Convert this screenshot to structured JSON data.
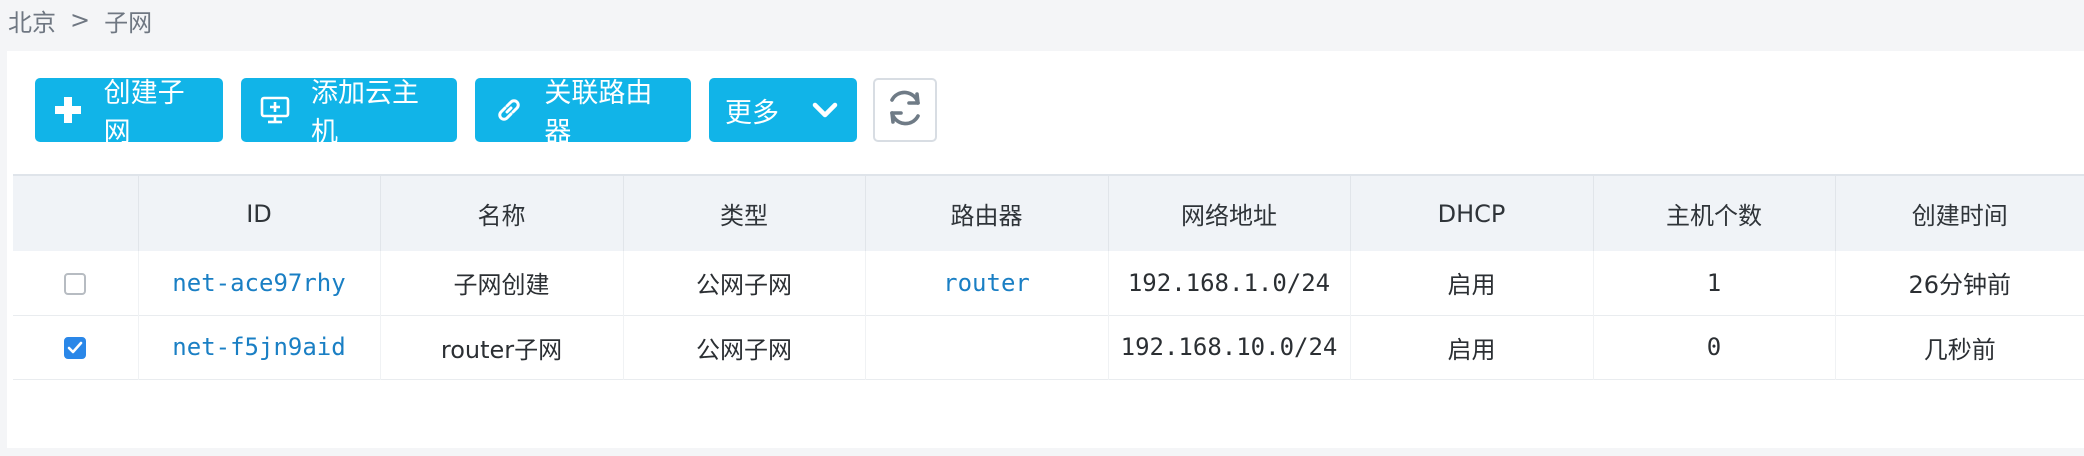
{
  "breadcrumb": {
    "region": "北京",
    "separator": ">",
    "current": "子网"
  },
  "toolbar": {
    "create_label": "创建子网",
    "add_host_label": "添加云主机",
    "link_router_label": "关联路由器",
    "more_label": "更多",
    "accent_color": "#11b4e8"
  },
  "table": {
    "headers": [
      "ID",
      "名称",
      "类型",
      "路由器",
      "网络地址",
      "DHCP",
      "主机个数",
      "创建时间"
    ],
    "rows": [
      {
        "checked": false,
        "id": "net-ace97rhy",
        "name": "子网创建",
        "type": "公网子网",
        "router": "router",
        "network": "192.168.1.0/24",
        "dhcp": "启用",
        "hosts": "1",
        "created": "26分钟前"
      },
      {
        "checked": true,
        "id": "net-f5jn9aid",
        "name": "router子网",
        "type": "公网子网",
        "router": "",
        "network": "192.168.10.0/24",
        "dhcp": "启用",
        "hosts": "0",
        "created": "几秒前"
      }
    ]
  }
}
